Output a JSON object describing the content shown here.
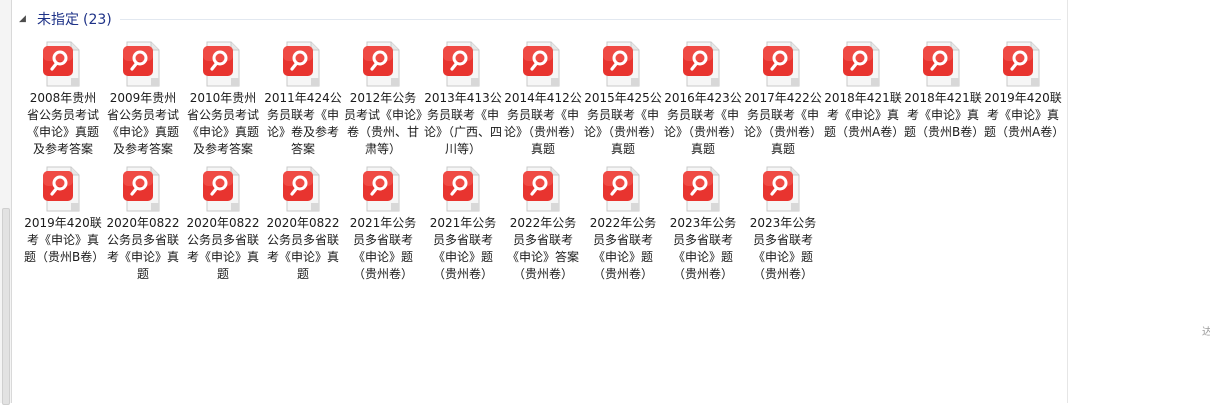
{
  "group": {
    "title": "未指定",
    "count": "(23)"
  },
  "files": [
    {
      "name": "2008年贵州省公务员考试《申论》真题及参考答案"
    },
    {
      "name": "2009年贵州省公务员考试《申论》真题及参考答案"
    },
    {
      "name": "2010年贵州省公务员考试《申论》真题及参考答案"
    },
    {
      "name": "2011年424公务员联考《申论》卷及参考答案"
    },
    {
      "name": "2012年公务员考试《申论》卷（贵州、甘肃等）"
    },
    {
      "name": "2013年413公务员联考《申论》（广西、四川等）"
    },
    {
      "name": "2014年412公务员联考《申论》（贵州卷）真题"
    },
    {
      "name": "2015年425公务员联考《申论》（贵州卷）真题"
    },
    {
      "name": "2016年423公务员联考《申论》（贵州卷）真题"
    },
    {
      "name": "2017年422公务员联考《申论》（贵州卷）真题"
    },
    {
      "name": "2018年421联考《申论》真题（贵州A卷）"
    },
    {
      "name": "2018年421联考《申论》真题（贵州B卷）"
    },
    {
      "name": "2019年420联考《申论》真题（贵州A卷）"
    },
    {
      "name": "2019年420联考《申论》真题（贵州B卷）"
    },
    {
      "name": "2020年0822公务员多省联考《申论》真题"
    },
    {
      "name": "2020年0822公务员多省联考《申论》真题"
    },
    {
      "name": "2020年0822公务员多省联考《申论》真题"
    },
    {
      "name": "2021年公务员多省联考《申论》题（贵州卷）"
    },
    {
      "name": "2021年公务员多省联考《申论》题（贵州卷）"
    },
    {
      "name": "2022年公务员多省联考《申论》答案（贵州卷）"
    },
    {
      "name": "2022年公务员多省联考《申论》题（贵州卷）"
    },
    {
      "name": "2023年公务员多省联考《申论》题（贵州卷）"
    },
    {
      "name": "2023年公务员多省联考《申论》题（贵州卷）"
    }
  ],
  "icons": {
    "chevron": "chevron-down-icon",
    "file": "pdf-file-icon"
  },
  "colors": {
    "icon_red": "#e8342f",
    "title_blue": "#1e3287"
  },
  "edge_glyph": "达"
}
